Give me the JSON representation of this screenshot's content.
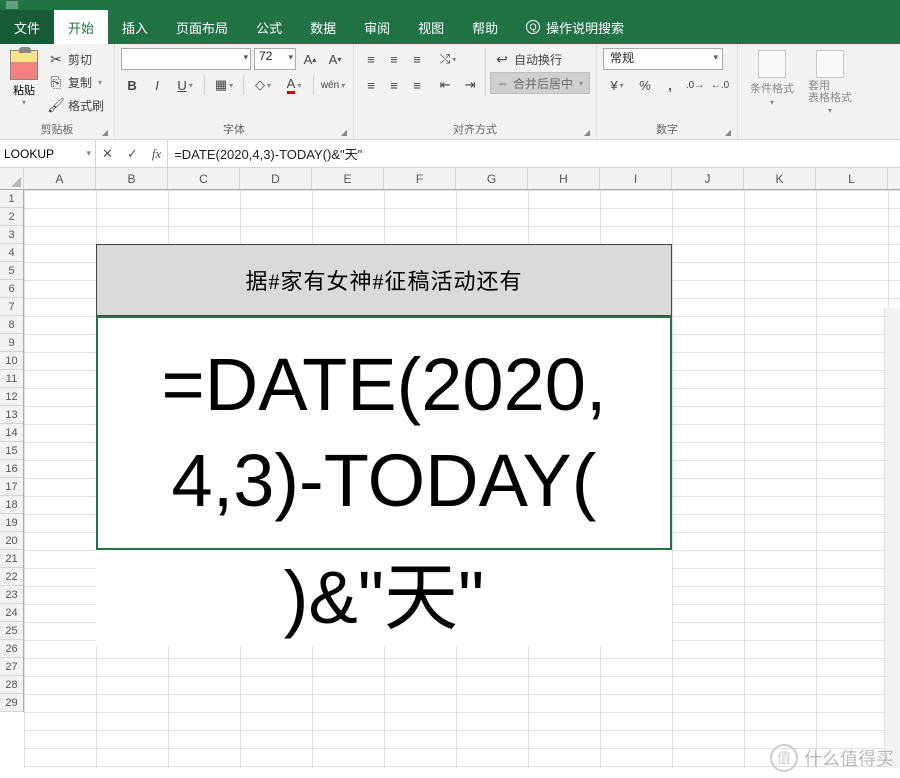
{
  "tabs": {
    "file": "文件",
    "home": "开始",
    "insert": "插入",
    "layout": "页面布局",
    "formulas": "公式",
    "data": "数据",
    "review": "审阅",
    "view": "视图",
    "help": "帮助",
    "tell": "操作说明搜索"
  },
  "ribbon": {
    "clipboard": {
      "paste": "粘贴",
      "cut": "剪切",
      "copy": "复制",
      "painter": "格式刷",
      "label": "剪贴板"
    },
    "font": {
      "name": "",
      "size": "72",
      "label": "字体"
    },
    "align": {
      "wrap": "自动换行",
      "merge": "合并后居中",
      "label": "对齐方式"
    },
    "number": {
      "format": "常规",
      "label": "数字"
    },
    "styles": {
      "cond": "条件格式",
      "table": "套用\n表格格式"
    }
  },
  "formula_bar": {
    "name": "LOOKUP",
    "cancel": "✕",
    "enter": "✓",
    "fx": "fx",
    "value": "=DATE(2020,4,3)-TODAY()&\"天\""
  },
  "sheet": {
    "cols": [
      "A",
      "B",
      "C",
      "D",
      "E",
      "F",
      "G",
      "H",
      "I",
      "J",
      "K",
      "L"
    ],
    "row_count": 29,
    "header_text": "据#家有女神#征稿活动还有",
    "big_l1": "=DATE(2020,",
    "big_l2": "4,3)-TODAY(",
    "big_l3": ")&\"天\""
  },
  "watermark": {
    "logo": "值",
    "text": "什么值得买"
  }
}
